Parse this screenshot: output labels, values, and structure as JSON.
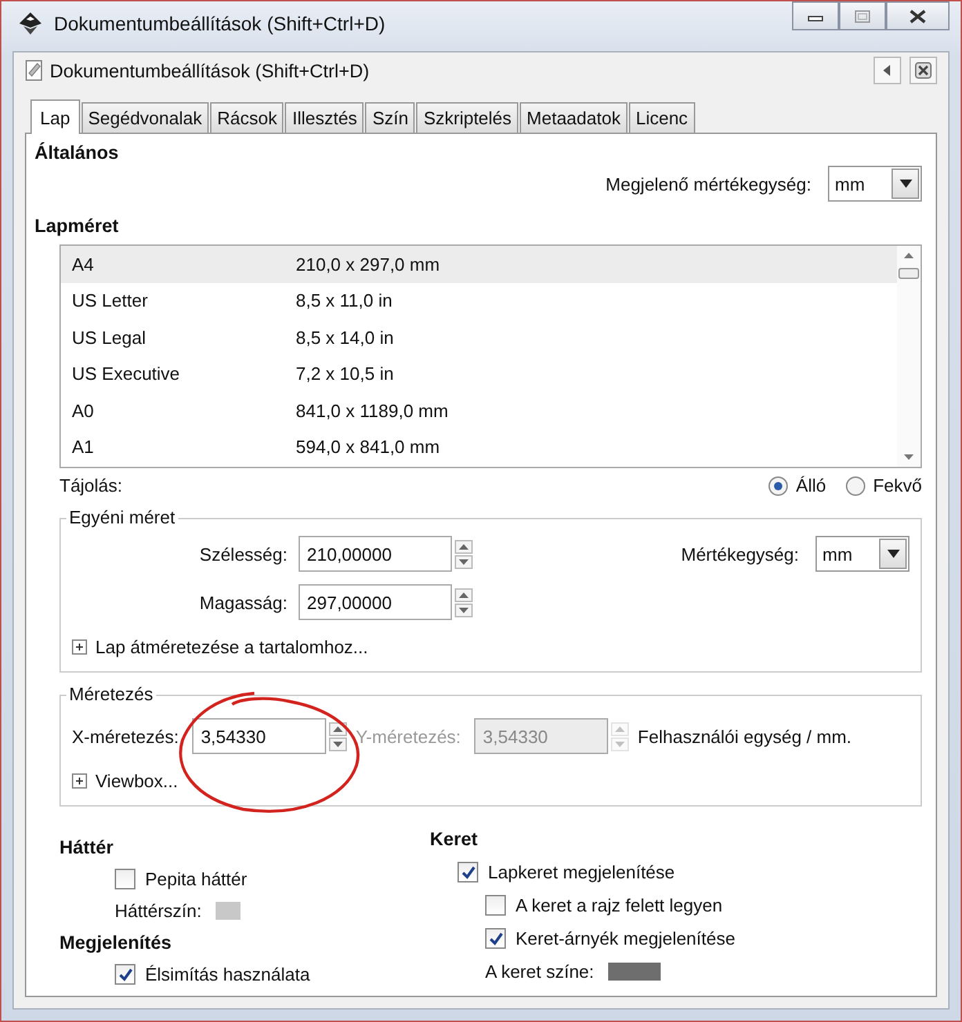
{
  "window": {
    "title": "Dokumentumbeállítások (Shift+Ctrl+D)"
  },
  "panel": {
    "title": "Dokumentumbeállítások (Shift+Ctrl+D)"
  },
  "tabs": [
    {
      "label": "Lap",
      "selected": true
    },
    {
      "label": "Segédvonalak",
      "selected": false
    },
    {
      "label": "Rácsok",
      "selected": false
    },
    {
      "label": "Illesztés",
      "selected": false
    },
    {
      "label": "Szín",
      "selected": false
    },
    {
      "label": "Szkriptelés",
      "selected": false
    },
    {
      "label": "Metaadatok",
      "selected": false
    },
    {
      "label": "Licenc",
      "selected": false
    }
  ],
  "general": {
    "heading": "Általános",
    "display_units": {
      "label": "Megjelenő mértékegység:",
      "value": "mm"
    }
  },
  "page_size": {
    "heading": "Lapméret",
    "rows": [
      {
        "name": "A4",
        "size": "210,0 x 297,0 mm",
        "selected": true
      },
      {
        "name": "US Letter",
        "size": "8,5 x 11,0 in",
        "selected": false
      },
      {
        "name": "US Legal",
        "size": "8,5 x 14,0 in",
        "selected": false
      },
      {
        "name": "US Executive",
        "size": "7,2 x 10,5 in",
        "selected": false
      },
      {
        "name": "A0",
        "size": "841,0 x 1189,0 mm",
        "selected": false
      },
      {
        "name": "A1",
        "size": "594,0 x 841,0 mm",
        "selected": false
      }
    ]
  },
  "orientation": {
    "label": "Tájolás:",
    "options": [
      {
        "label": "Álló",
        "selected": true
      },
      {
        "label": "Fekvő",
        "selected": false
      }
    ]
  },
  "custom_size": {
    "legend": "Egyéni méret",
    "width": {
      "label": "Szélesség:",
      "value": "210,00000"
    },
    "height": {
      "label": "Magasság:",
      "value": "297,00000"
    },
    "units": {
      "label": "Mértékegység:",
      "value": "mm"
    },
    "expander": {
      "label": "Lap átméretezése a tartalomhoz...",
      "expanded": false
    }
  },
  "scale": {
    "legend": "Méretezés",
    "fields": [
      {
        "label": "X-méretezés:",
        "value": "3,54330",
        "disabled": false
      },
      {
        "label": "Y-méretezés:",
        "value": "3,54330",
        "disabled": true
      }
    ],
    "unit_text": "Felhasználói egység / mm.",
    "expander": {
      "label": "Viewbox...",
      "expanded": false
    }
  },
  "background": {
    "heading": "Háttér",
    "checkerboard": {
      "label": "Pepita háttér",
      "checked": false
    },
    "color_label": "Háttérszín:",
    "color": "#c8c8c8"
  },
  "display": {
    "heading": "Megjelenítés",
    "antialias": {
      "label": "Élsimítás használata",
      "checked": true
    }
  },
  "border": {
    "heading": "Keret",
    "options": [
      {
        "label": "Lapkeret megjelenítése",
        "checked": true,
        "children": [
          {
            "label": "A keret a rajz felett legyen",
            "checked": false
          },
          {
            "label": "Keret-árnyék megjelenítése",
            "checked": true
          }
        ]
      }
    ],
    "color_label": "A keret színe:",
    "color": "#6e6e6e"
  }
}
